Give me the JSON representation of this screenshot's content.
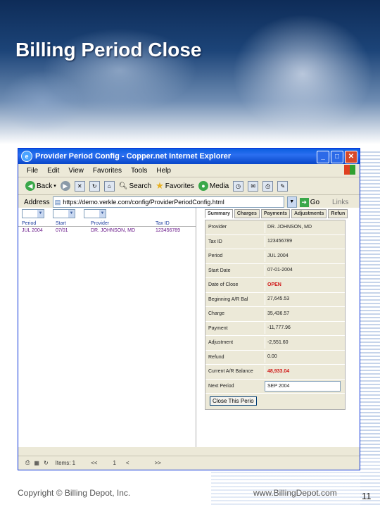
{
  "slide": {
    "title": "Billing Period Close",
    "footer_left": "Copyright © Billing Depot, Inc.",
    "footer_right": "www.BillingDepot.com",
    "page_number": "11"
  },
  "browser": {
    "title": "Provider Period Config - Copper.net Internet Explorer",
    "menu": [
      "File",
      "Edit",
      "View",
      "Favorites",
      "Tools",
      "Help"
    ],
    "toolbar": {
      "back": "Back",
      "search": "Search",
      "favorites": "Favorites",
      "media": "Media"
    },
    "address": {
      "label": "Address",
      "url": "https://demo.verkle.com/config/ProviderPeriodConfig.html",
      "go": "Go",
      "links": "Links"
    },
    "status": {
      "items_label": "Items: 1",
      "nav_first": "<<",
      "page": "1",
      "nav_prev": "<",
      "nav_next": ">>"
    }
  },
  "grid": {
    "headers": [
      "Period",
      "Start",
      "Provider",
      "Tax ID"
    ],
    "rows": [
      [
        "JUL 2004",
        "07/01",
        "DR. JOHNSON, MD",
        "123456789"
      ]
    ]
  },
  "tabs": [
    "Summary",
    "Charges",
    "Payments",
    "Adjustments",
    "Refun"
  ],
  "form": {
    "fields": [
      {
        "label": "Provider",
        "value": "DR. JOHNSON, MD"
      },
      {
        "label": "Tax ID",
        "value": "123456789"
      },
      {
        "label": "Period",
        "value": "JUL 2004"
      },
      {
        "label": "Start Date",
        "value": "07-01-2004"
      },
      {
        "label": "Date of Close",
        "value": "OPEN"
      },
      {
        "label": "Beginning A/R Bal",
        "value": "27,645.53"
      },
      {
        "label": "Charge",
        "value": "35,436.57"
      },
      {
        "label": "Payment",
        "value": "-11,777.96"
      },
      {
        "label": "Adjustment",
        "value": "-2,551.60"
      },
      {
        "label": "Refund",
        "value": "0.00"
      },
      {
        "label": "Current A/R Balance",
        "value": "48,933.04"
      }
    ],
    "next_period_label": "Next Period",
    "next_period_value": "SEP 2004",
    "close_button": "Close This Perio"
  },
  "colors": {
    "accent_red": "#d01818",
    "titlebar_blue": "#0a5ee0",
    "link_purple": "#6a1a8a"
  }
}
